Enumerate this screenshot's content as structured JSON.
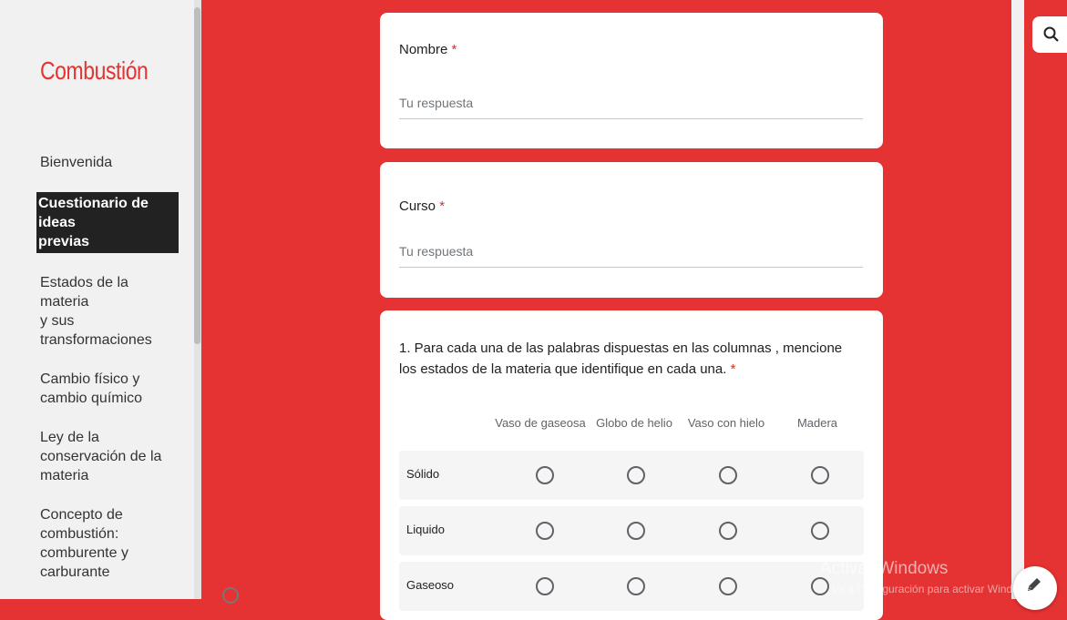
{
  "sidebar": {
    "site_title": "Combustión",
    "items": [
      {
        "label": "Bienvenida"
      },
      {
        "label_lines": [
          "Cuestionario de ideas",
          "previas"
        ]
      },
      {
        "label_lines": [
          "Estados de la materia",
          "y sus",
          "transformaciones"
        ]
      },
      {
        "label_lines": [
          "Cambio físico y",
          "cambio químico"
        ]
      },
      {
        "label_lines": [
          "Ley de la",
          "conservación de la",
          "materia"
        ]
      },
      {
        "label_lines": [
          "Concepto de",
          "combustión:",
          "comburente y",
          "carburante"
        ]
      }
    ]
  },
  "form": {
    "name_question": "Nombre",
    "course_question": "Curso",
    "required_mark": "*",
    "answer_placeholder": "Tu respuesta",
    "q1_text": "1. Para cada una de las palabras dispuestas en las columnas , mencione los estados de la materia que identifique en cada una.",
    "columns": [
      "Vaso de gaseosa",
      "Globo de helio",
      "Vaso con hielo",
      "Madera"
    ],
    "rows": [
      "Sólido",
      "Liquido",
      "Gaseoso"
    ]
  },
  "icons": {
    "search": "search-icon",
    "edit": "pencil-icon",
    "scroll": "circle-icon"
  },
  "watermark": {
    "title": "Activar Windows",
    "subtitle": "Ve a Configuración para activar Windows."
  },
  "colors": {
    "accent": "#e53232",
    "sidebar_bg": "#f1f1f1",
    "required": "#d93025"
  }
}
